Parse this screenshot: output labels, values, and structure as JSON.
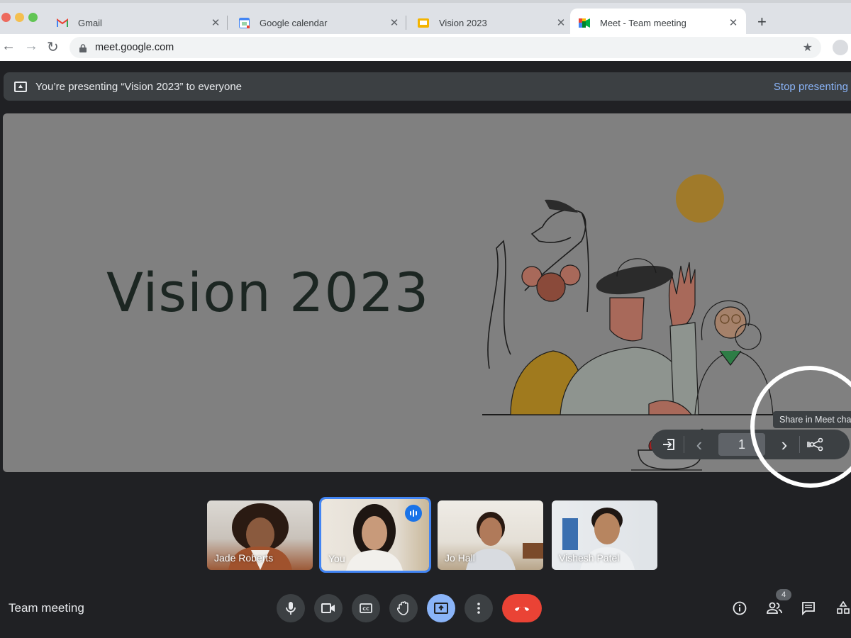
{
  "browser": {
    "tabs": [
      {
        "label": "Gmail",
        "icon": "gmail-icon",
        "active": false
      },
      {
        "label": "Google calendar",
        "icon": "calendar-icon",
        "active": false
      },
      {
        "label": "Vision 2023",
        "icon": "slides-icon",
        "active": false
      },
      {
        "label": "Meet - Team meeting",
        "icon": "meet-icon",
        "active": true
      }
    ],
    "tab_close_glyph": "✕",
    "new_tab_glyph": "+",
    "back_glyph": "←",
    "forward_glyph": "→",
    "reload_glyph": "↻",
    "url": "meet.google.com",
    "bookmark_glyph": "★"
  },
  "meet": {
    "banner": {
      "message": "You’re presenting “Vision 2023” to everyone",
      "stop_label": "Stop presenting"
    },
    "slide": {
      "title": "Vision 2023",
      "colors": {
        "sun": "#a07a2a",
        "skin": "#a8695a",
        "mustard": "#a07a1e",
        "sage": "#8e948f",
        "green": "#2e7d46",
        "red": "#a02020"
      }
    },
    "slide_controls": {
      "exit_glyph": "⇥",
      "prev_glyph": "‹",
      "page": "1",
      "next_glyph": "›",
      "tooltip": "Share in Meet cha"
    },
    "participants": [
      {
        "name": "Jade Roberts",
        "speaking": false,
        "bg": [
          "#d9d6d2",
          "#a0522d"
        ]
      },
      {
        "name": "You",
        "speaking": true,
        "bg": [
          "#e4ddd2",
          "#efece8"
        ]
      },
      {
        "name": "Jo Hall",
        "speaking": false,
        "bg": [
          "#e8e4dc",
          "#cdd2d6"
        ]
      },
      {
        "name": "Vishesh Patel",
        "speaking": false,
        "bg": [
          "#e6e9ec",
          "#d8dde2"
        ]
      }
    ],
    "meeting_name": "Team meeting",
    "people_count": "4",
    "accent": "#8ab4f8",
    "end_call_color": "#ea4335"
  }
}
